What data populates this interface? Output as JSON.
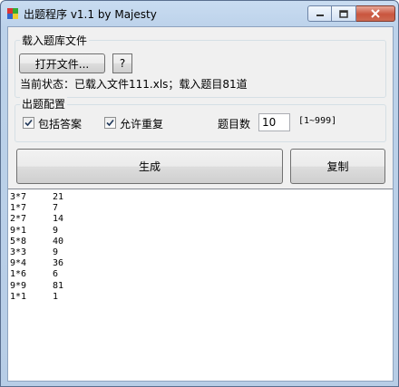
{
  "window": {
    "title": "出题程序 v1.1 by Majesty"
  },
  "load_group": {
    "label": "载入题库文件",
    "open_button": "打开文件...",
    "help_button": "?",
    "status": "当前状态：已载入文件111.xls；载入题目81道"
  },
  "config_group": {
    "label": "出题配置",
    "include_answers": {
      "label": "包括答案",
      "checked": true
    },
    "allow_repeat": {
      "label": "允许重复",
      "checked": true
    },
    "count_label": "题目数",
    "count_value": "10",
    "count_range": "[1~999]"
  },
  "actions": {
    "generate": "生成",
    "copy": "复制"
  },
  "output": {
    "rows": [
      {
        "expr": "3*7",
        "answer": "21"
      },
      {
        "expr": "1*7",
        "answer": "7"
      },
      {
        "expr": "2*7",
        "answer": "14"
      },
      {
        "expr": "9*1",
        "answer": "9"
      },
      {
        "expr": "5*8",
        "answer": "40"
      },
      {
        "expr": "3*3",
        "answer": "9"
      },
      {
        "expr": "9*4",
        "answer": "36"
      },
      {
        "expr": "1*6",
        "answer": "6"
      },
      {
        "expr": "9*9",
        "answer": "81"
      },
      {
        "expr": "1*1",
        "answer": "1"
      }
    ]
  }
}
